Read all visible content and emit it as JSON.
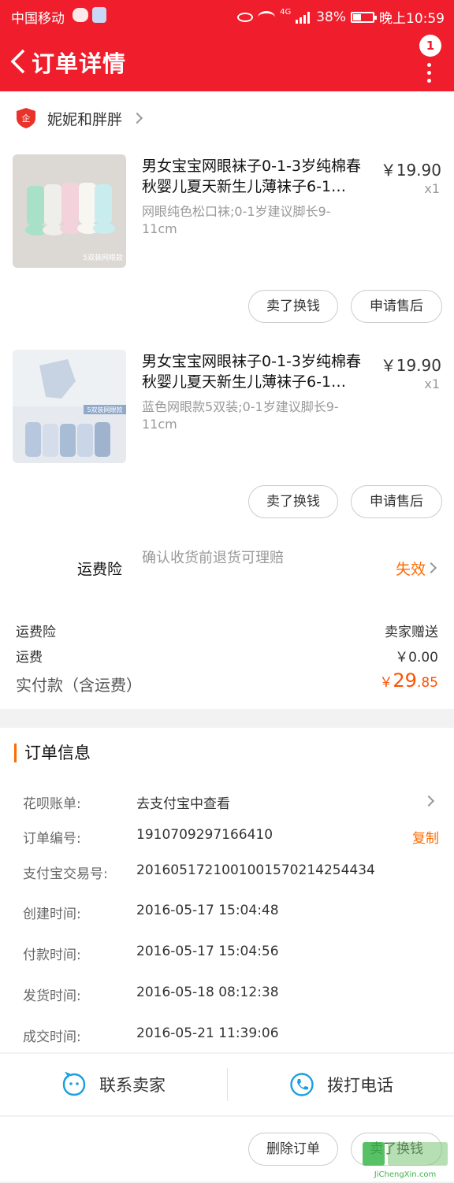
{
  "status_bar": {
    "carrier": "中国移动",
    "network": "4G",
    "battery": "38%",
    "time": "晚上10:59"
  },
  "nav": {
    "title": "订单详情",
    "badge": "1"
  },
  "shop": {
    "name": "妮妮和胖胖"
  },
  "items": [
    {
      "name": "男女宝宝网眼袜子0-1-3岁纯棉春秋婴儿夏天新生儿薄袜子6-1…",
      "spec": "网眼纯色松口袜;0-1岁建议脚长9-11cm",
      "price": "￥19.90",
      "qty": "x1",
      "image_caption": "5双装网眼款",
      "btn_sell": "卖了换钱",
      "btn_after": "申请售后"
    },
    {
      "name": "男女宝宝网眼袜子0-1-3岁纯棉春秋婴儿夏天新生儿薄袜子6-1…",
      "spec": "蓝色网眼款5双装;0-1岁建议脚长9-11cm",
      "price": "￥19.90",
      "qty": "x1",
      "image_caption": "5双装网眼款",
      "btn_sell": "卖了换钱",
      "btn_after": "申请售后"
    }
  ],
  "insurance": {
    "label": "运费险",
    "description": "确认收货前退货可理赔",
    "status": "失效"
  },
  "fees": {
    "insurance_label": "运费险",
    "insurance_value": "卖家赠送",
    "shipping_label": "运费",
    "shipping_value": "￥0.00",
    "total_label": "实付款（含运费）",
    "total_symbol": "￥",
    "total_int": "29",
    "total_dec": ".85"
  },
  "order_info": {
    "heading": "订单信息",
    "huabei_label": "花呗账单:",
    "huabei_value": "去支付宝中查看",
    "order_no_label": "订单编号:",
    "order_no": "1910709297166410",
    "copy": "复制",
    "alipay_label": "支付宝交易号:",
    "alipay_no": "2016051721001001570214254434",
    "created_label": "创建时间:",
    "created": "2016-05-17 15:04:48",
    "paid_label": "付款时间:",
    "paid": "2016-05-17 15:04:56",
    "shipped_label": "发货时间:",
    "shipped": "2016-05-18 08:12:38",
    "done_label": "成交时间:",
    "done": "2016-05-21 11:39:06"
  },
  "contact": {
    "seller": "联系卖家",
    "phone": "拨打电话"
  },
  "bottom": {
    "delete": "删除订单",
    "sell": "卖了换钱"
  },
  "watermark": {
    "text": "JiChengXin.com"
  },
  "colors": {
    "brand_red": "#f01e2c",
    "accent_orange": "#ff6a00",
    "price_orange": "#ff5000",
    "icon_blue": "#1a9fe0"
  }
}
